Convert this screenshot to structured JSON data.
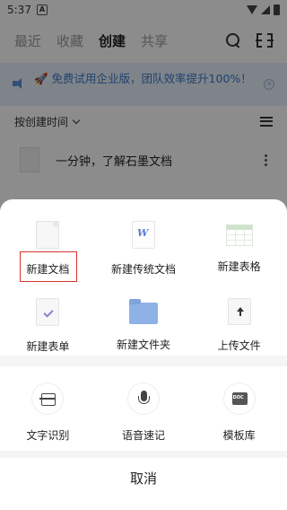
{
  "status_bar": {
    "time": "5:37",
    "notif_icon": "A"
  },
  "top_nav": {
    "tabs": [
      {
        "label": "最近"
      },
      {
        "label": "收藏"
      },
      {
        "label": "创建"
      },
      {
        "label": "共享"
      }
    ],
    "active_tab": "创建"
  },
  "promo": {
    "text": "🚀 免费试用企业版，团队效率提升100%！"
  },
  "sort": {
    "label": "按创建时间"
  },
  "document": {
    "name": "一分钟，了解石墨文档"
  },
  "sheet": {
    "create_items": [
      {
        "label": "新建文档",
        "icon": "doc-icon"
      },
      {
        "label": "新建传统文档",
        "icon": "word-doc-icon"
      },
      {
        "label": "新建表格",
        "icon": "spreadsheet-icon"
      },
      {
        "label": "新建表单",
        "icon": "form-icon"
      },
      {
        "label": "新建文件夹",
        "icon": "folder-icon"
      },
      {
        "label": "上传文件",
        "icon": "upload-icon"
      }
    ],
    "tools": [
      {
        "label": "文字识别",
        "icon": "ocr-icon"
      },
      {
        "label": "语音速记",
        "icon": "microphone-icon"
      },
      {
        "label": "模板库",
        "icon": "template-icon",
        "icon_text": "DOC"
      }
    ],
    "cancel_label": "取消"
  },
  "colors": {
    "accent": "#3a78c9",
    "highlight": "#d9312b",
    "promo_bg": "#e8f1fb"
  }
}
